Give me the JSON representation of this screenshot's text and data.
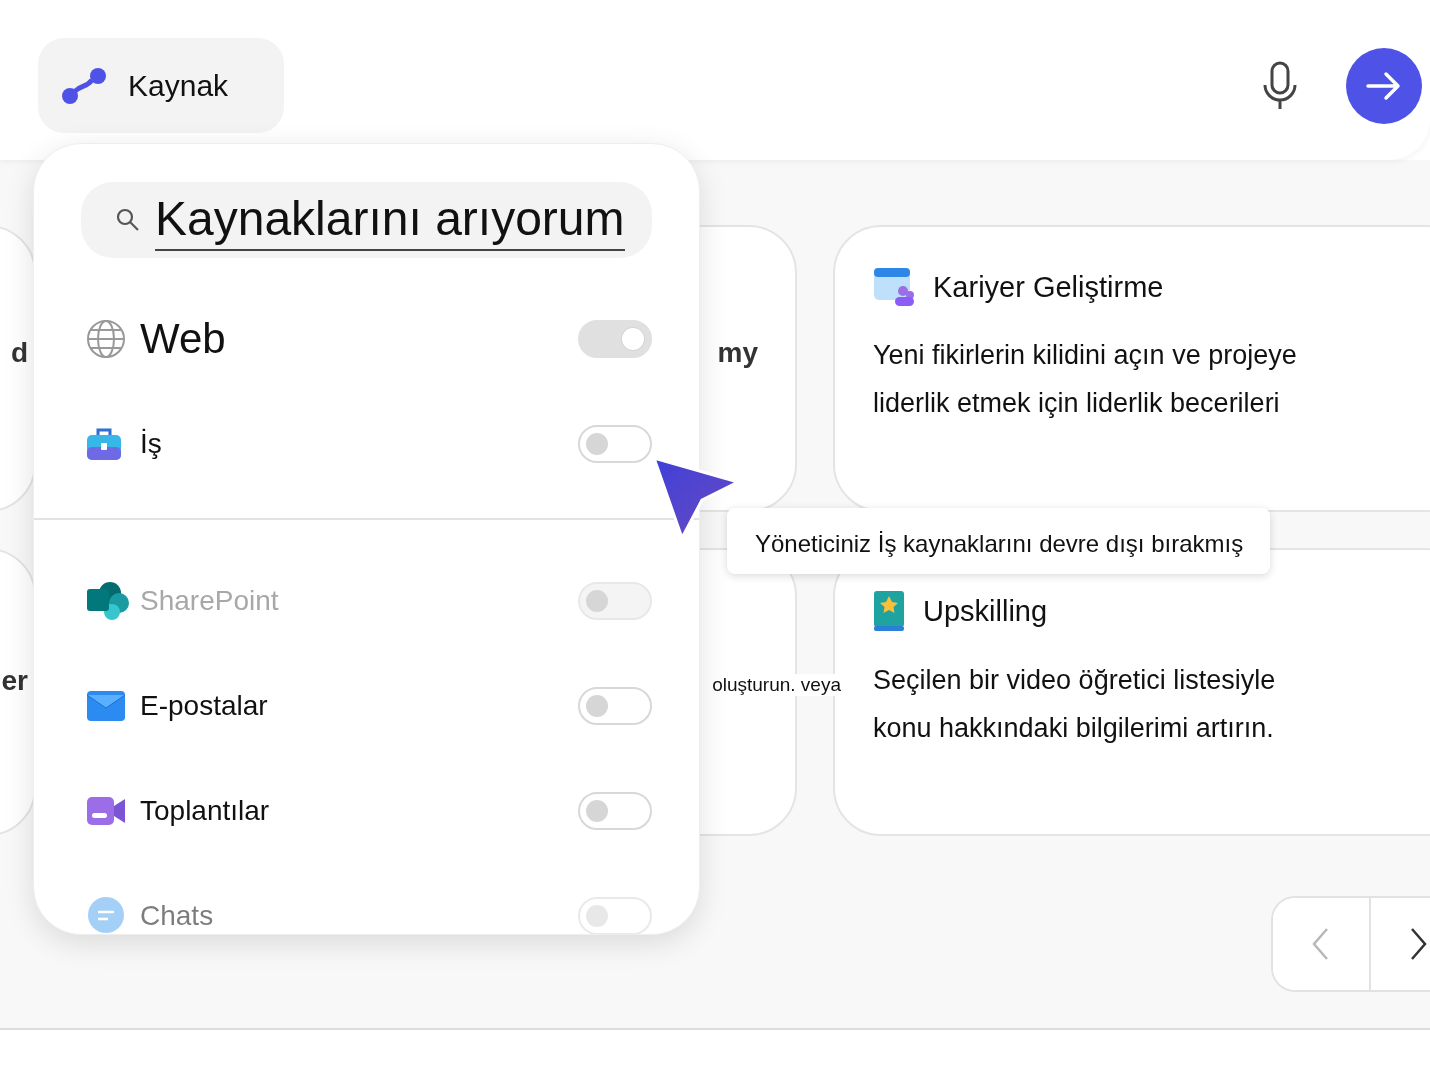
{
  "source_button": {
    "label": "Kaynak"
  },
  "cards": [
    {
      "kind": "partial",
      "text": "d"
    },
    {
      "kind": "partial",
      "text": "my"
    },
    {
      "kind": "full",
      "title": "Kariyer Geliştirme",
      "description": "Yeni fikirlerin kilidini açın ve projeye liderlik etmek için liderlik becerileri"
    },
    {
      "kind": "partial",
      "text": "er"
    },
    {
      "kind": "partial",
      "text": "oluşturun. veya"
    },
    {
      "kind": "full",
      "title": "Upskilling",
      "description": "Seçilen bir video öğretici listesiyle konu hakkındaki bilgilerimi artırın."
    }
  ],
  "source_panel": {
    "search": {
      "value": "Kaynaklarını arıyorum"
    },
    "sources": [
      {
        "label": "Web",
        "on": true,
        "disabled": true
      },
      {
        "label": "İş",
        "on": false,
        "disabled": false
      }
    ],
    "work_sources": [
      {
        "label": "SharePoint",
        "on": false,
        "disabled": true
      },
      {
        "label": "E-postalar",
        "on": false,
        "disabled": false
      },
      {
        "label": "Toplantılar",
        "on": false,
        "disabled": false
      },
      {
        "label": "Chats",
        "on": false,
        "disabled": false
      }
    ]
  },
  "tooltip": {
    "text": "Yöneticiniz İş kaynaklarını devre dışı bırakmış"
  }
}
